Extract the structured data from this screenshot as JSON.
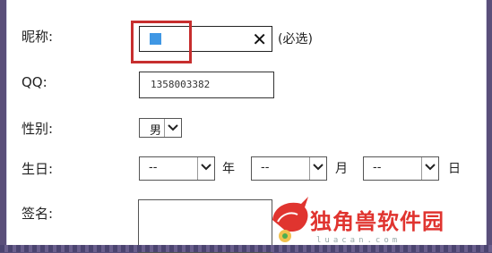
{
  "form": {
    "nickname_label": "昵称:",
    "nickname_hint": "(必选)",
    "qq_label": "QQ:",
    "qq_value": "1358003382",
    "gender_label": "性别:",
    "gender_value": "男",
    "birthday_label": "生日:",
    "year_value": "--",
    "year_unit": "年",
    "month_value": "--",
    "month_unit": "月",
    "day_value": "--",
    "day_unit": "日",
    "signature_label": "签名:"
  },
  "watermark": {
    "title": "独角兽软件园",
    "url": "luacan.com"
  },
  "colors": {
    "highlight": "#c72e2e",
    "accent_square": "#3f97e4",
    "logo_red": "#e0342f"
  }
}
